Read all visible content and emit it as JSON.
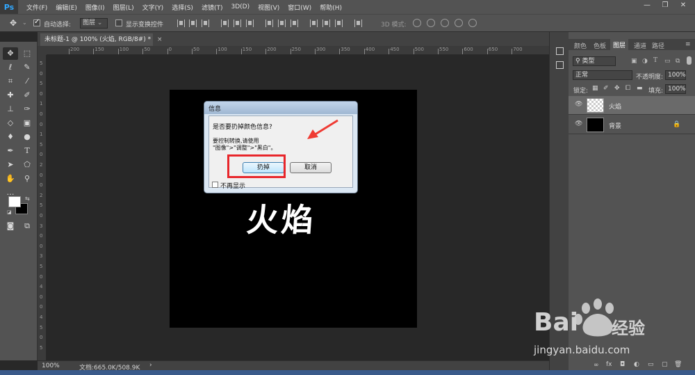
{
  "menubar": {
    "logo": "Ps",
    "items": [
      "文件(F)",
      "编辑(E)",
      "图像(I)",
      "图层(L)",
      "文字(Y)",
      "选择(S)",
      "滤镜(T)",
      "3D(D)",
      "视图(V)",
      "窗口(W)",
      "帮助(H)"
    ],
    "win_min": "—",
    "win_max": "❐",
    "win_close": "✕"
  },
  "options": {
    "auto_select_label": "自动选择:",
    "auto_select_value": "图层",
    "show_transform_label": "显示变换控件",
    "mode_3d_label": "3D 模式:"
  },
  "document": {
    "tab_title": "未标题-1 @ 100% (火焰, RGB/8#) *",
    "tab_close": "×",
    "canvas_text": "火焰",
    "ruler_h": [
      "200",
      "150",
      "100",
      "50",
      "0",
      "50",
      "100",
      "150",
      "200",
      "250",
      "300",
      "350",
      "400",
      "450",
      "500",
      "550",
      "600",
      "650",
      "700"
    ],
    "ruler_v": [
      "5",
      "0",
      "5",
      "0",
      "1",
      "0",
      "0",
      "1",
      "5",
      "0",
      "2",
      "0",
      "0",
      "2",
      "5",
      "0",
      "3",
      "0",
      "0",
      "3",
      "5",
      "0",
      "4",
      "0",
      "0",
      "4",
      "5",
      "0",
      "5"
    ]
  },
  "dialog": {
    "title": "信息",
    "question": "是否要扔掉颜色信息?",
    "hint_line1": "要控制转换,请使用",
    "hint_line2": "\"图像\">\"调整\">\"黑白\"。",
    "ok_label": "扔掉",
    "cancel_label": "取消",
    "dont_show_label": "不再显示"
  },
  "status": {
    "zoom": "100%",
    "doc_size": "文档:665.0K/508.9K",
    "more": "›"
  },
  "panel": {
    "tabs": [
      "颜色",
      "色板",
      "图层",
      "通道",
      "路径"
    ],
    "active_tab": "图层",
    "filter_kind": "类型",
    "blend_mode": "正常",
    "opacity_label": "不透明度:",
    "opacity_value": "100%",
    "lock_label": "锁定:",
    "fill_label": "填充:",
    "fill_value": "100%",
    "layers": [
      {
        "name": "火焰",
        "selected": true,
        "thumb": "transparent"
      },
      {
        "name": "背景",
        "selected": false,
        "thumb": "black",
        "locked": true
      }
    ],
    "bottom_icons": [
      "∞",
      "fx",
      "◘",
      "◐",
      "▭",
      "▢",
      "🗑"
    ]
  },
  "watermark": {
    "brand_text": "Bai",
    "brand_suffix": "经验",
    "url": "jingyan.baidu.com"
  },
  "colors": {
    "accent": "#31a8ff",
    "highlight": "#e8262b",
    "arrow": "#ef3b33"
  }
}
